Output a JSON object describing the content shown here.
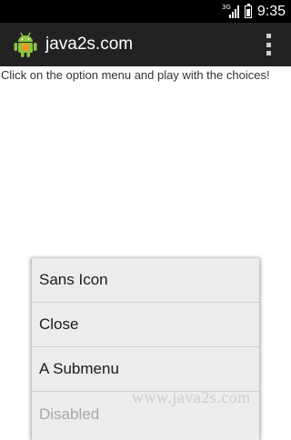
{
  "status_bar": {
    "network_type": "3G",
    "time": "9:35",
    "icons": [
      "signal-icon",
      "battery-icon"
    ]
  },
  "action_bar": {
    "title": "java2s.com",
    "app_icon": "android-icon",
    "overflow_icon": "overflow-menu-icon",
    "background_color": "#222222"
  },
  "content": {
    "text": "Click on the option menu and play with the choices!"
  },
  "options_menu": {
    "items": [
      {
        "label": "Sans Icon",
        "enabled": true
      },
      {
        "label": "Close",
        "enabled": true
      },
      {
        "label": "A Submenu",
        "enabled": true
      },
      {
        "label": "Disabled",
        "enabled": false
      }
    ],
    "background_color": "#ececec"
  },
  "watermark": {
    "text": "www.java2s.com"
  }
}
